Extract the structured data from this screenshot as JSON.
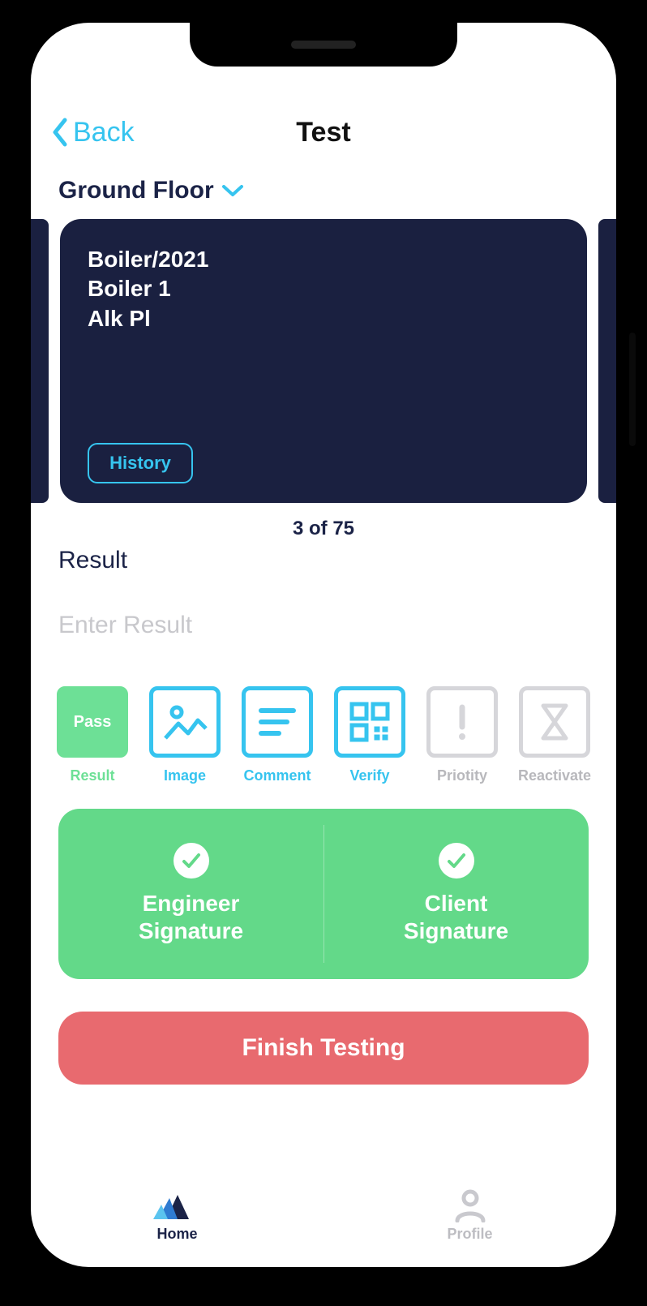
{
  "nav": {
    "back": "Back",
    "title": "Test"
  },
  "location": {
    "label": "Ground Floor"
  },
  "card": {
    "line1": "Boiler/2021",
    "line2": "Boiler 1",
    "line3": "Alk Pl",
    "history": "History"
  },
  "counter": "3 of 75",
  "result": {
    "section_label": "Result",
    "placeholder": "Enter Result"
  },
  "actions": {
    "result": {
      "label": "Result",
      "pass_text": "Pass"
    },
    "image": {
      "label": "Image"
    },
    "comment": {
      "label": "Comment"
    },
    "verify": {
      "label": "Verify"
    },
    "priority": {
      "label": "Priotity"
    },
    "reactivate": {
      "label": "Reactivate"
    }
  },
  "signatures": {
    "engineer": "Engineer\nSignature",
    "client": "Client\nSignature"
  },
  "finish": "Finish Testing",
  "tabs": {
    "home": "Home",
    "profile": "Profile"
  }
}
